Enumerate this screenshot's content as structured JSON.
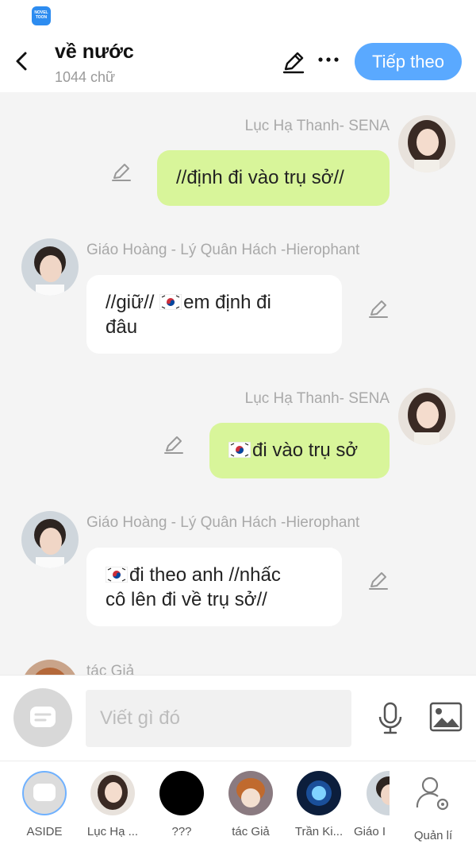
{
  "app": {
    "badge_text": "NOVEL TOON"
  },
  "header": {
    "title": "về nước",
    "word_count": "1044 chữ",
    "next_label": "Tiếp theo"
  },
  "messages": [
    {
      "side": "right",
      "name": "Lục Hạ Thanh- SENA",
      "text": "//định đi vào trụ sở//",
      "flag": false
    },
    {
      "side": "left",
      "name": "Giáo Hoàng - Lý Quân Hách -Hierophant",
      "text_line1": "//giữ// ",
      "text_line1b": "em định đi",
      "text_line2": "đâu",
      "flag": true
    },
    {
      "side": "right",
      "name": "Lục Hạ Thanh- SENA",
      "text": "đi vào trụ sở",
      "flag": true
    },
    {
      "side": "left",
      "name": "Giáo Hoàng - Lý Quân Hách -Hierophant",
      "text_line1": "đi theo anh //nhấc",
      "text_line2": "cô lên đi về trụ sở//",
      "flag": true
    },
    {
      "side": "left",
      "name": "tác Giả"
    }
  ],
  "input": {
    "placeholder": "Viết gì đó"
  },
  "roles": [
    {
      "label": "ASIDE"
    },
    {
      "label": "Lục Hạ ..."
    },
    {
      "label": "???"
    },
    {
      "label": "tác Giả"
    },
    {
      "label": "Trần Ki..."
    },
    {
      "label": "Giáo I"
    },
    {
      "label": "Quản lí"
    }
  ],
  "colors": {
    "accent": "#5aa9ff",
    "bubble_self": "#d8f59a",
    "bubble_other": "#ffffff",
    "background": "#f4f4f4"
  }
}
